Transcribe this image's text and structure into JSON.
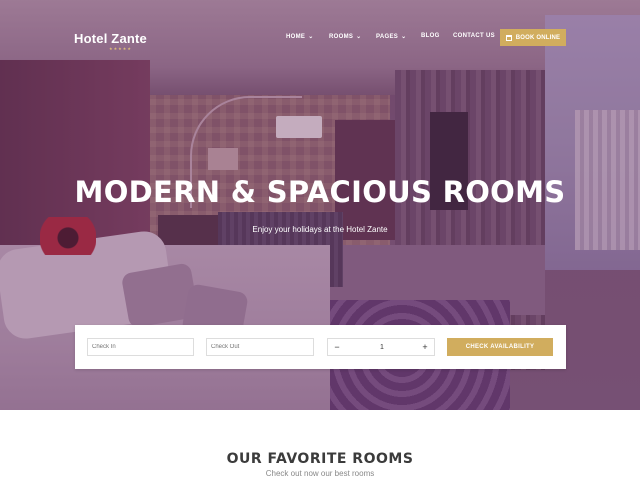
{
  "brand": {
    "name": "Hotel Zante",
    "stars": "★★★★★"
  },
  "nav": {
    "items": [
      {
        "label": "HOME",
        "caret": "⌄"
      },
      {
        "label": "ROOMS",
        "caret": "⌄"
      },
      {
        "label": "PAGES",
        "caret": "⌄"
      },
      {
        "label": "BLOG",
        "caret": ""
      },
      {
        "label": "CONTACT US",
        "caret": ""
      }
    ],
    "book_button": "BOOK ONLINE"
  },
  "hero": {
    "title": "MODERN & SPACIOUS ROOMS",
    "subtitle": "Enjoy your holidays at the Hotel Zante"
  },
  "booking": {
    "check_in_placeholder": "Check In",
    "check_out_placeholder": "Check Out",
    "minus": "−",
    "plus": "+",
    "guests": "1",
    "availability_button": "CHECK AVAILABILITY"
  },
  "section": {
    "title": "OUR FAVORITE ROOMS",
    "subtitle": "Check out now our best rooms"
  },
  "colors": {
    "accent": "#d1ad5e",
    "overlay": "#6e3c6e"
  },
  "icons": {
    "book_button_icon": "calendar-icon"
  }
}
